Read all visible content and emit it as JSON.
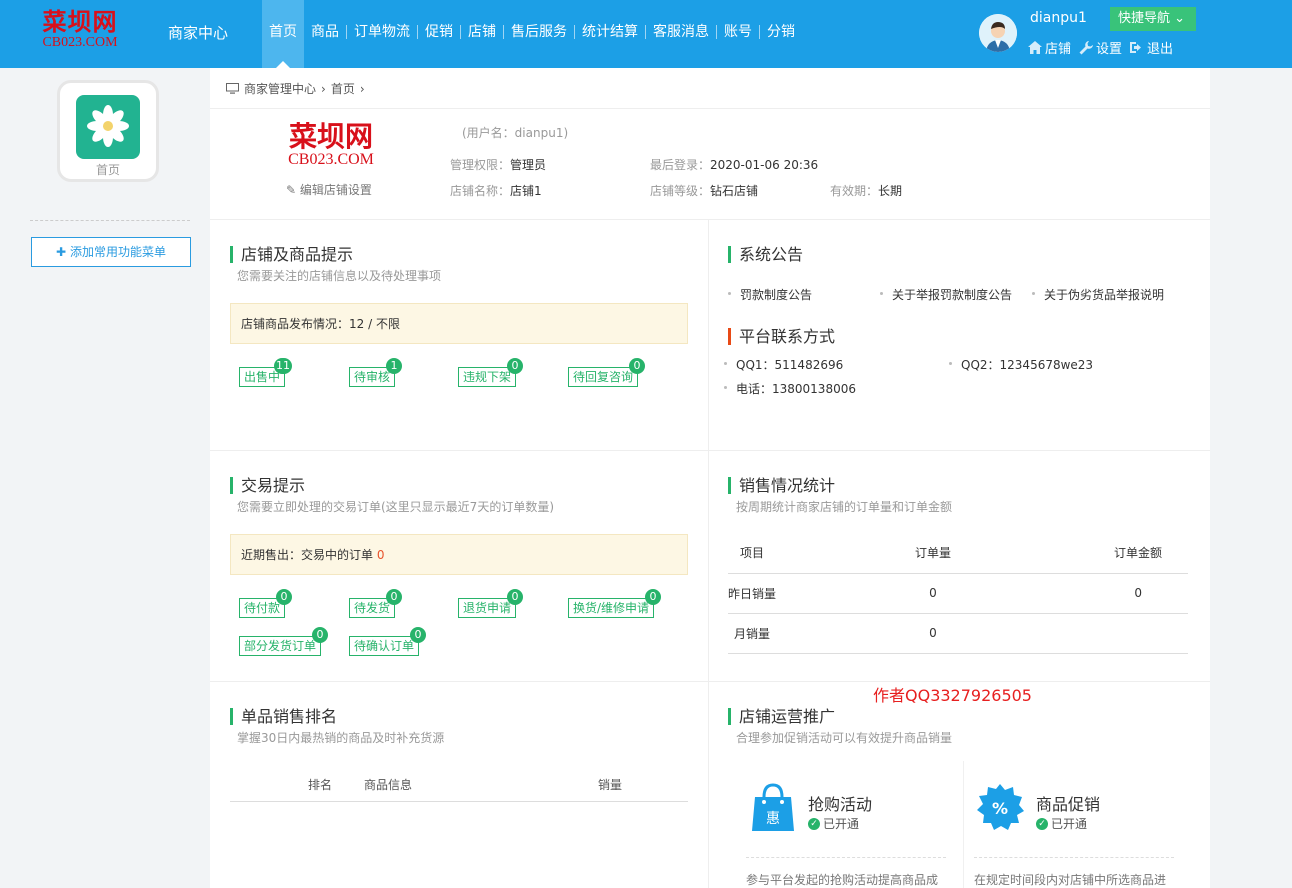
{
  "header": {
    "logo_cn": "菜坝网",
    "logo_en": "CB023.COM",
    "center_title": "商家中心",
    "nav": [
      "首页",
      "商品",
      "订单物流",
      "促销",
      "店铺",
      "售后服务",
      "统计结算",
      "客服消息",
      "账号",
      "分销"
    ],
    "username": "dianpu1",
    "quick_nav": "快捷导航",
    "links": {
      "shop": "店铺",
      "settings": "设置",
      "logout": "退出"
    }
  },
  "sidebar": {
    "icon_label": "首页",
    "add_menu": "添加常用功能菜单"
  },
  "breadcrumb": [
    "商家管理中心",
    "首页"
  ],
  "shop": {
    "logo_cn": "菜坝网",
    "logo_en": "CB023.COM",
    "edit": "编辑店铺设置",
    "username_line": "(用户名：dianpu1)",
    "perm_label": "管理权限：",
    "perm_value": "管理员",
    "last_login_label": "最后登录：",
    "last_login_value": "2020-01-06 20:36",
    "name_label": "店铺名称：",
    "name_value": "店铺1",
    "level_label": "店铺等级：",
    "level_value": "钻石店铺",
    "valid_label": "有效期：",
    "valid_value": "长期"
  },
  "store_tips": {
    "title": "店铺及商品提示",
    "sub": "您需要关注的店铺信息以及待处理事项",
    "publish": "店铺商品发布情况：12 /  不限",
    "tags": [
      {
        "label": "出售中",
        "count": "11"
      },
      {
        "label": "待审核",
        "count": "1"
      },
      {
        "label": "违规下架",
        "count": "0"
      },
      {
        "label": "待回复咨询",
        "count": "0"
      }
    ]
  },
  "announce": {
    "title": "系统公告",
    "items": [
      "罚款制度公告",
      "关于举报罚款制度公告",
      "关于伪劣货品举报说明"
    ],
    "contact_title": "平台联系方式",
    "qq1": "QQ1：511482696",
    "qq2": "QQ2：12345678we23",
    "phone": "电话：13800138006"
  },
  "trade": {
    "title": "交易提示",
    "sub": "您需要立即处理的交易订单(这里只显示最近7天的订单数量)",
    "recent_label": "近期售出：交易中的订单",
    "recent_value": "0",
    "tags": [
      {
        "label": "待付款",
        "count": "0"
      },
      {
        "label": "待发货",
        "count": "0"
      },
      {
        "label": "退货申请",
        "count": "0"
      },
      {
        "label": "换货/维修申请",
        "count": "0"
      },
      {
        "label": "部分发货订单",
        "count": "0"
      },
      {
        "label": "待确认订单",
        "count": "0"
      }
    ]
  },
  "sales": {
    "title": "销售情况统计",
    "sub": "按周期统计商家店铺的订单量和订单金额",
    "headers": [
      "项目",
      "订单量",
      "订单金额"
    ],
    "rows": [
      {
        "name": "昨日销量",
        "qty": "0",
        "amount": "0"
      },
      {
        "name": "月销量",
        "qty": "0",
        "amount": ""
      }
    ]
  },
  "ranking": {
    "title": "单品销售排名",
    "sub": "掌握30日内最热销的商品及时补充货源",
    "headers": [
      "排名",
      "商品信息",
      "销量"
    ]
  },
  "promo": {
    "title": "店铺运营推广",
    "sub": "合理参加促销活动可以有效提升商品销量",
    "cards": [
      {
        "name": "抢购活动",
        "status": "已开通",
        "desc": "参与平台发起的抢购活动提高商品成"
      },
      {
        "name": "商品促销",
        "status": "已开通",
        "desc": "在规定时间段内对店铺中所选商品进"
      }
    ]
  },
  "author_note": "作者QQ3327926505",
  "colors": {
    "header_bg": "#1c9fe6",
    "accent_green": "#27b36a",
    "quick_nav_bg": "#39c37a",
    "link_blue": "#2a9be0",
    "author_red": "#e71f1f"
  }
}
